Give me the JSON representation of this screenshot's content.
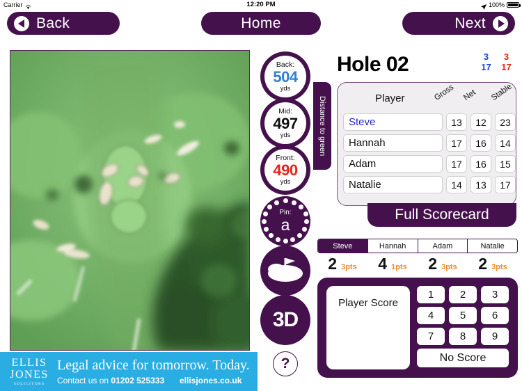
{
  "statusbar": {
    "carrier": "Carrier",
    "wifi_icon": "wifi-icon",
    "time": "12:20 PM",
    "location_icon": "location-arrow-icon",
    "battery": "100%"
  },
  "topnav": {
    "back": "Back",
    "home": "Home",
    "next": "Next",
    "back_icon": "chevron-left-circle-icon",
    "next_icon": "chevron-right-circle-icon"
  },
  "map": {
    "name": "golf-hole-aerial-map"
  },
  "distances": {
    "group_label": "Distance to green",
    "unit": "yds",
    "items": [
      {
        "label": "Back:",
        "value": "504",
        "unit": "yds",
        "color": "#2f7fd4"
      },
      {
        "label": "Mid:",
        "value": "497",
        "unit": "yds",
        "color": "#111111"
      },
      {
        "label": "Front:",
        "value": "490",
        "unit": "yds",
        "color": "#e8231b"
      }
    ]
  },
  "pin": {
    "label": "Pin:",
    "value": "a"
  },
  "buttons": {
    "green_icon": "green-with-flag-icon",
    "three_d": "3D",
    "help": "?"
  },
  "hole": {
    "title": "Hole 02",
    "par_blue": "3",
    "par_red": "3",
    "si_blue": "17",
    "si_red": "17"
  },
  "scorecard": {
    "header_player": "Player",
    "columns": [
      "Gross",
      "Net",
      "Stable"
    ],
    "rows": [
      {
        "name": "Steve",
        "gross": "13",
        "net": "12",
        "stable": "23",
        "selected": true
      },
      {
        "name": "Hannah",
        "gross": "17",
        "net": "16",
        "stable": "14",
        "selected": false
      },
      {
        "name": "Adam",
        "gross": "17",
        "net": "16",
        "stable": "15",
        "selected": false
      },
      {
        "name": "Natalie",
        "gross": "14",
        "net": "13",
        "stable": "17",
        "selected": false
      }
    ],
    "full_scorecard_label": "Full Scorecard"
  },
  "player_tabs": [
    {
      "label": "Steve",
      "active": true,
      "score": "2",
      "points": "3pts"
    },
    {
      "label": "Hannah",
      "active": false,
      "score": "4",
      "points": "1pts"
    },
    {
      "label": "Adam",
      "active": false,
      "score": "2",
      "points": "3pts"
    },
    {
      "label": "Natalie",
      "active": false,
      "score": "2",
      "points": "3pts"
    }
  ],
  "keypad": {
    "player_score_label": "Player Score",
    "keys": [
      [
        "1",
        "2",
        "3"
      ],
      [
        "4",
        "5",
        "6"
      ],
      [
        "7",
        "8",
        "9"
      ]
    ],
    "no_score_label": "No Score"
  },
  "ad": {
    "logo_line1": "ELLIS",
    "logo_line2": "JONES",
    "logo_line3": "SOLICITORS",
    "headline": "Legal advice for tomorrow. Today.",
    "contact": "Contact us on",
    "phone": "01202 525333",
    "url": "ellisjones.co.uk"
  },
  "colors": {
    "purple": "#45114d",
    "ad_blue": "#29ade3",
    "orange": "#f08a2a",
    "blue": "#1546d6",
    "red": "#e8231b"
  }
}
